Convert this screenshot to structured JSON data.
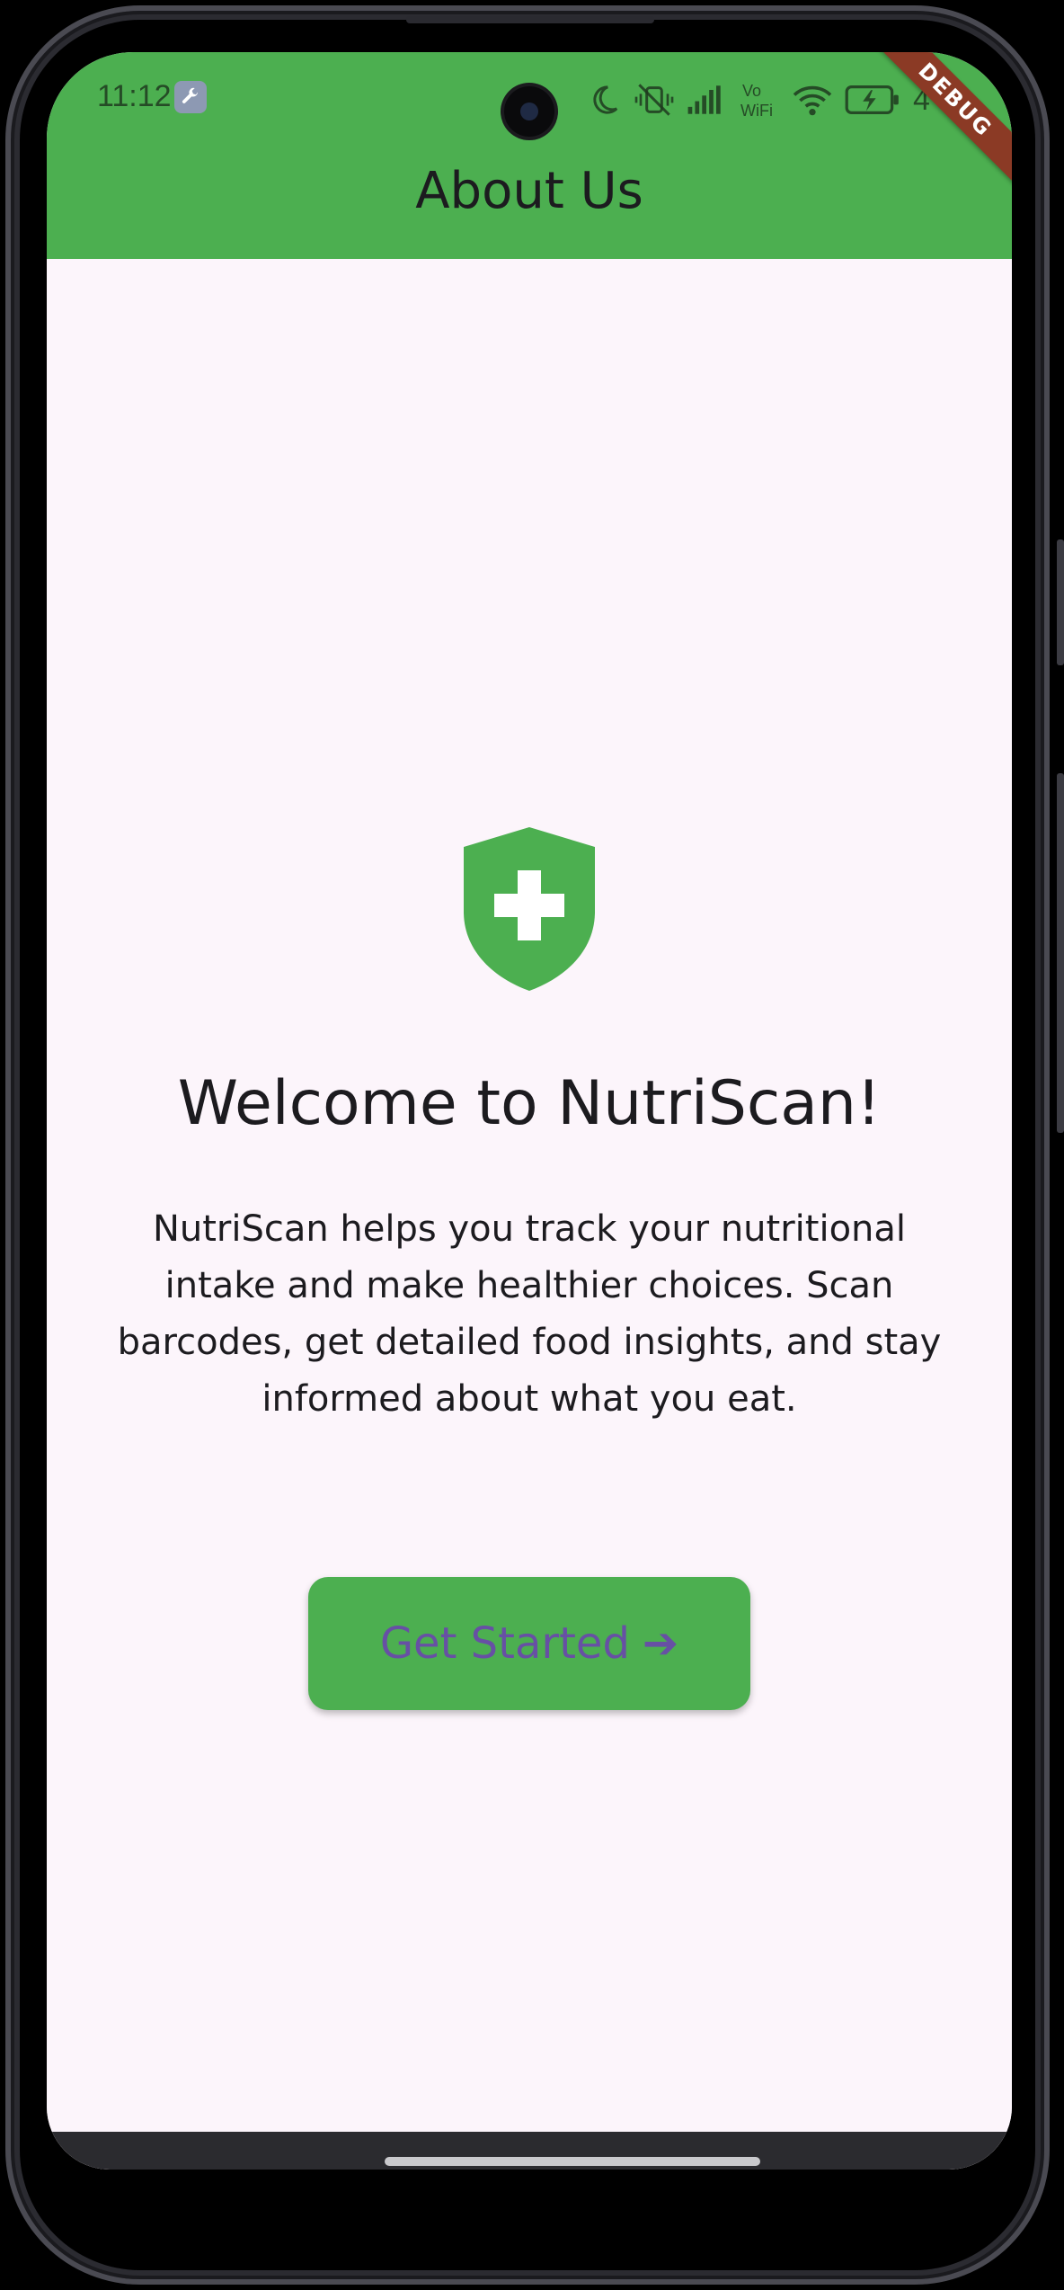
{
  "status_bar": {
    "time": "11:12",
    "wrench_icon": "wrench-icon",
    "icons": [
      "moon-icon",
      "vibrate-off-icon",
      "signal-icon",
      "vowifi-icon",
      "wifi-icon",
      "battery-charging-icon"
    ],
    "vowifi_top": "Vo",
    "vowifi_bottom": "WiFi",
    "battery_level": "4"
  },
  "debug_banner": {
    "label": "DEBUG",
    "color": "#8b3a25"
  },
  "app_bar": {
    "title": "About Us",
    "color": "#4caf50"
  },
  "main": {
    "icon": "shield-plus-icon",
    "heading": "Welcome to NutriScan!",
    "description": "NutriScan helps you track your nutritional intake and make healthier choices. Scan barcodes, get detailed food insights, and stay informed about what you eat.",
    "button": {
      "label": "Get Started",
      "icon": "arrow-right-icon",
      "arrow": "➔",
      "background": "#4caf50",
      "text_color": "#6750a4"
    }
  },
  "colors": {
    "background": "#fcf5fb",
    "text": "#1c1b1f",
    "accent": "#4caf50"
  }
}
